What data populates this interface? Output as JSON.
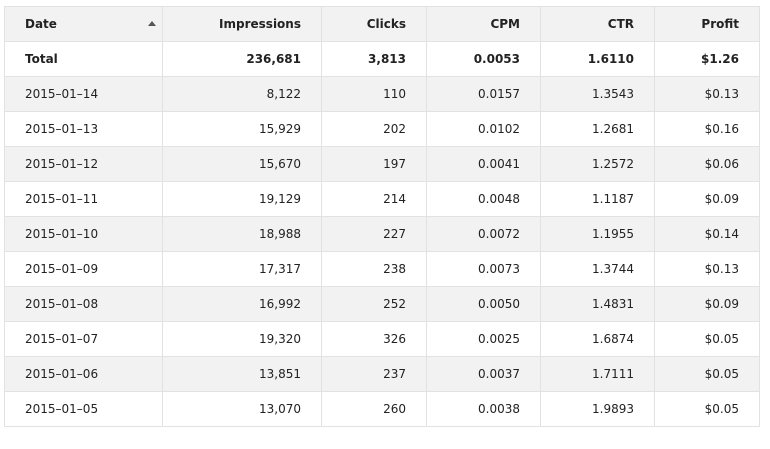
{
  "table": {
    "headers": {
      "date": "Date",
      "impressions": "Impressions",
      "clicks": "Clicks",
      "cpm": "CPM",
      "ctr": "CTR",
      "profit": "Profit"
    },
    "sort": {
      "column": "date",
      "icon": "sort-ascending-icon"
    },
    "total": {
      "label": "Total",
      "impressions": "236,681",
      "clicks": "3,813",
      "cpm": "0.0053",
      "ctr": "1.6110",
      "profit": "$1.26"
    },
    "rows": [
      {
        "date": "2015–01–14",
        "impressions": "8,122",
        "clicks": "110",
        "cpm": "0.0157",
        "ctr": "1.3543",
        "profit": "$0.13"
      },
      {
        "date": "2015–01–13",
        "impressions": "15,929",
        "clicks": "202",
        "cpm": "0.0102",
        "ctr": "1.2681",
        "profit": "$0.16"
      },
      {
        "date": "2015–01–12",
        "impressions": "15,670",
        "clicks": "197",
        "cpm": "0.0041",
        "ctr": "1.2572",
        "profit": "$0.06"
      },
      {
        "date": "2015–01–11",
        "impressions": "19,129",
        "clicks": "214",
        "cpm": "0.0048",
        "ctr": "1.1187",
        "profit": "$0.09"
      },
      {
        "date": "2015–01–10",
        "impressions": "18,988",
        "clicks": "227",
        "cpm": "0.0072",
        "ctr": "1.1955",
        "profit": "$0.14"
      },
      {
        "date": "2015–01–09",
        "impressions": "17,317",
        "clicks": "238",
        "cpm": "0.0073",
        "ctr": "1.3744",
        "profit": "$0.13"
      },
      {
        "date": "2015–01–08",
        "impressions": "16,992",
        "clicks": "252",
        "cpm": "0.0050",
        "ctr": "1.4831",
        "profit": "$0.09"
      },
      {
        "date": "2015–01–07",
        "impressions": "19,320",
        "clicks": "326",
        "cpm": "0.0025",
        "ctr": "1.6874",
        "profit": "$0.05"
      },
      {
        "date": "2015–01–06",
        "impressions": "13,851",
        "clicks": "237",
        "cpm": "0.0037",
        "ctr": "1.7111",
        "profit": "$0.05"
      },
      {
        "date": "2015–01–05",
        "impressions": "13,070",
        "clicks": "260",
        "cpm": "0.0038",
        "ctr": "1.9893",
        "profit": "$0.05"
      }
    ]
  }
}
